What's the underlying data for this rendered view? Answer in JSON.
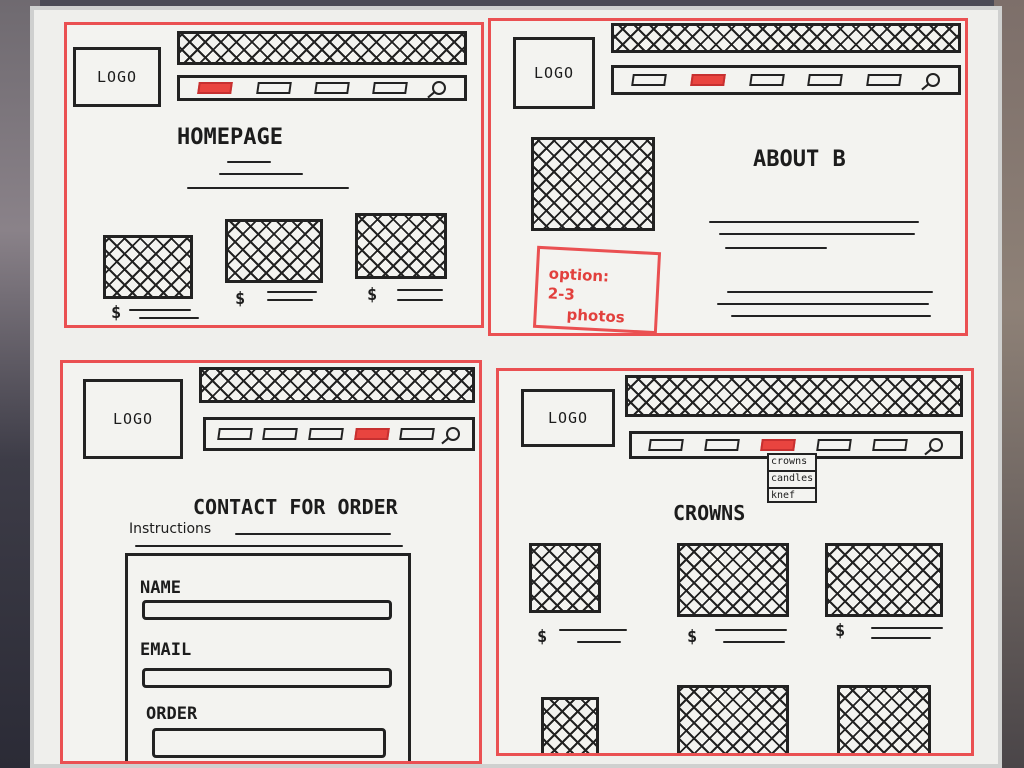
{
  "panels": {
    "homepage": {
      "logo": "LOGO",
      "title": "HOMEPAGE",
      "prices": [
        "$",
        "$",
        "$"
      ]
    },
    "about": {
      "logo": "LOGO",
      "title": "ABOUT B",
      "note": {
        "line1": "option:",
        "line2": "2-3",
        "line3": "photos"
      }
    },
    "contact": {
      "logo": "LOGO",
      "title": "CONTACT FOR ORDER",
      "instructions": "Instructions",
      "fields": {
        "name": "NAME",
        "email": "EMAIL",
        "order": "ORDER"
      }
    },
    "crowns": {
      "logo": "LOGO",
      "title": "CROWNS",
      "dropdown": [
        "crowns",
        "candles",
        "knef"
      ],
      "prices": [
        "$",
        "$",
        "$"
      ]
    }
  },
  "colors": {
    "accent": "#ea5052",
    "ink": "#1c1c1c",
    "board": "#efefec"
  }
}
